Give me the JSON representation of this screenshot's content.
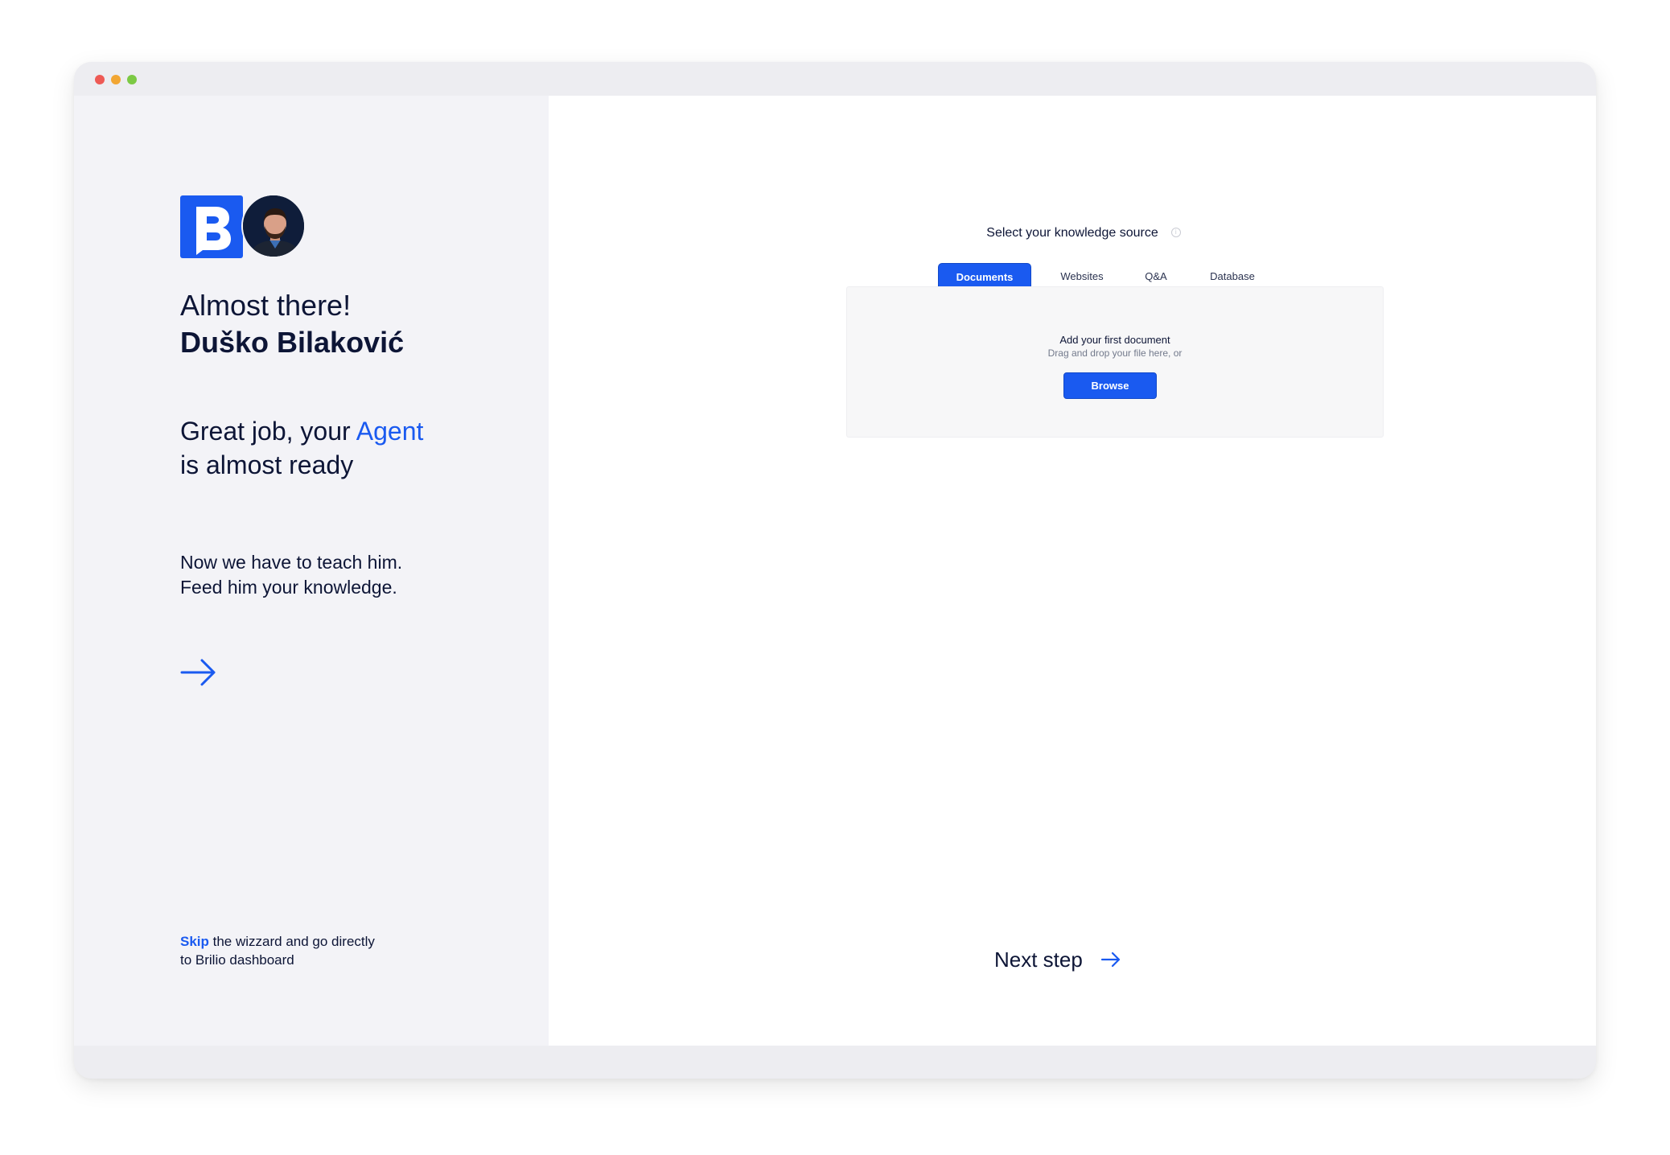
{
  "window": {
    "traffic_lights": {
      "close": "#ee5a55",
      "minimize": "#f2a633",
      "maximize": "#7cc944"
    }
  },
  "left": {
    "logo": {
      "letter": "B",
      "color": "#1a5af0",
      "icon": "brilio-logo"
    },
    "avatar_icon": "user-avatar-photo",
    "greeting": "Almost there!",
    "user_name": "Duško Bilaković",
    "headline_start": "Great job, your ",
    "headline_accent": "Agent",
    "headline_end": "is almost ready",
    "subtext_line1": "Now we have to teach him.",
    "subtext_line2": "Feed him your knowledge.",
    "continue_icon": "arrow-right-icon",
    "skip_link": "Skip",
    "skip_rest_line1": " the wizzard and go directly",
    "skip_rest_line2": "to Brilio dashboard"
  },
  "right": {
    "title": "Select your knowledge source",
    "info_icon": "info-icon",
    "tabs": [
      {
        "label": "Documents",
        "active": true
      },
      {
        "label": "Websites",
        "active": false
      },
      {
        "label": "Q&A",
        "active": false
      },
      {
        "label": "Database",
        "active": false
      }
    ],
    "upload": {
      "title": "Add your first document",
      "subtitle": "Drag and drop your file here, or",
      "button": "Browse"
    },
    "next_step": "Next step"
  },
  "colors": {
    "accent": "#1a5af0",
    "text": "#0d1536",
    "sidebar_bg": "#f3f3f7"
  }
}
